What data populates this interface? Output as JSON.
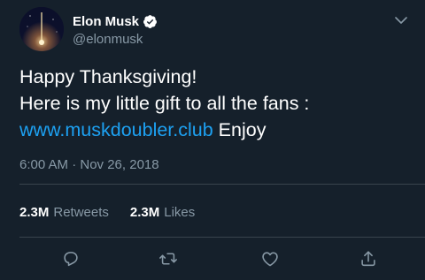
{
  "author": {
    "display_name": "Elon Musk",
    "handle": "@elonmusk",
    "verified": true
  },
  "tweet": {
    "line1": "Happy Thanksgiving!",
    "line2": "Here is my little gift to all the fans :",
    "link_text": "www.muskdoubler.club",
    "after_link": " Enjoy",
    "timestamp": "6:00 AM · Nov 26, 2018"
  },
  "stats": {
    "retweets_count": "2.3M",
    "retweets_label": "Retweets",
    "likes_count": "2.3M",
    "likes_label": "Likes"
  },
  "icons": {
    "menu": "chevron-down-icon",
    "verified": "verified-badge-icon",
    "reply": "reply-icon",
    "retweet": "retweet-icon",
    "like": "heart-icon",
    "share": "share-icon"
  },
  "colors": {
    "background": "#15202b",
    "text": "#ffffff",
    "secondary": "#8899a6",
    "link": "#1da1f2",
    "divider": "#38444d"
  }
}
